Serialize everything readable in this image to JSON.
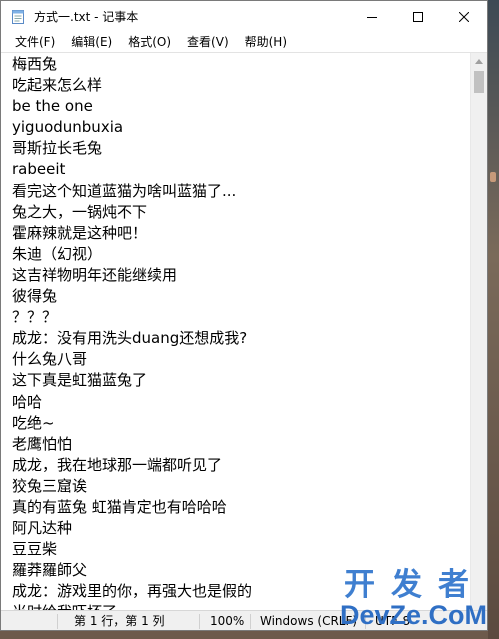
{
  "window": {
    "title": "方式一.txt - 记事本",
    "icon": "notepad-icon"
  },
  "controls": {
    "minimize_icon": "minimize-icon",
    "maximize_icon": "maximize-icon",
    "close_icon": "close-icon"
  },
  "menu": [
    {
      "label": "文件(F)"
    },
    {
      "label": "编辑(E)"
    },
    {
      "label": "格式(O)"
    },
    {
      "label": "查看(V)"
    },
    {
      "label": "帮助(H)"
    }
  ],
  "editor": {
    "lines": [
      "梅西兔",
      "吃起来怎么样",
      "be the one",
      "yiguodunbuxia",
      "哥斯拉长毛兔",
      "rabeeit",
      "看完这个知道蓝猫为啥叫蓝猫了...",
      "兔之大，一锅炖不下",
      "霍麻辣就是这种吧！",
      "朱迪（幻视）",
      "这吉祥物明年还能继续用",
      "彼得兔",
      "？？？",
      "成龙：没有用洗头duang还想成我?",
      "什么兔八哥",
      "这下真是虹猫蓝兔了",
      "哈哈",
      "吃绝~",
      "老鹰怕怕",
      "成龙，我在地球那一端都听见了",
      "狡兔三窟诶",
      "真的有蓝兔 虹猫肯定也有哈哈哈",
      "阿凡达种",
      "豆豆柴",
      "羅莽羅師父",
      "成龙：游戏里的你，再强大也是假的",
      "当时给我吓坏了"
    ]
  },
  "statusbar": {
    "position": "第 1 行，第 1 列",
    "zoom": "100%",
    "line_ending": "Windows (CRLF)",
    "encoding": "UTF-8"
  },
  "watermark": {
    "line1": "开发者",
    "line2": "DevZe.CoM"
  }
}
